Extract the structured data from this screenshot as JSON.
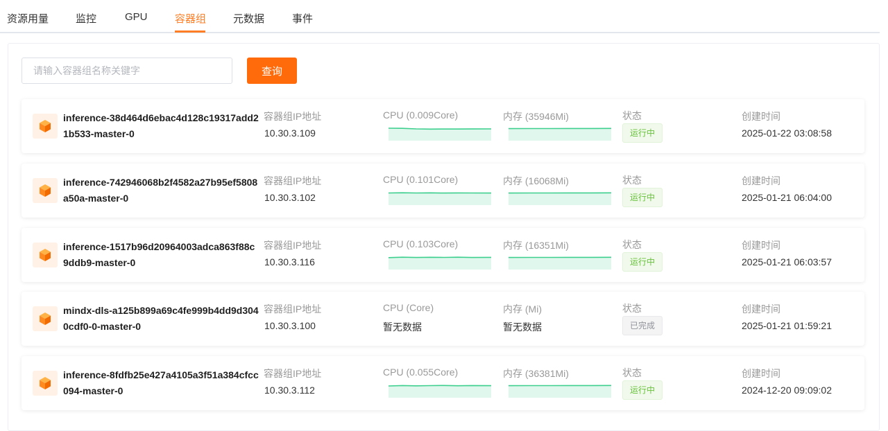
{
  "tabs": [
    {
      "label": "资源用量",
      "active": false
    },
    {
      "label": "监控",
      "active": false
    },
    {
      "label": "GPU",
      "active": false
    },
    {
      "label": "容器组",
      "active": true
    },
    {
      "label": "元数据",
      "active": false
    },
    {
      "label": "事件",
      "active": false
    }
  ],
  "search": {
    "placeholder": "请输入容器组名称关键字",
    "value": "",
    "button_label": "查询"
  },
  "colors": {
    "accent": "#ff7e26",
    "button": "#ff6a0a",
    "running": "#67c23a",
    "sparkline": "#3ccf8e"
  },
  "icons": {
    "pod": "cube-icon"
  },
  "labels": {
    "ip": "容器组IP地址",
    "status": "状态",
    "created": "创建时间"
  },
  "pods": [
    {
      "name": "inference-38d464d6ebac4d128c19317add21b533-master-0",
      "ip": "10.30.3.109",
      "cpu_label": "CPU (0.009Core)",
      "cpu_value": "",
      "mem_label": "内存 (35946Mi)",
      "mem_value": "",
      "has_chart": true,
      "status": "运行中",
      "status_type": "running",
      "created": "2025-01-22 03:08:58"
    },
    {
      "name": "inference-742946068b2f4582a27b95ef5808a50a-master-0",
      "ip": "10.30.3.102",
      "cpu_label": "CPU (0.101Core)",
      "cpu_value": "",
      "mem_label": "内存 (16068Mi)",
      "mem_value": "",
      "has_chart": true,
      "status": "运行中",
      "status_type": "running",
      "created": "2025-01-21 06:04:00"
    },
    {
      "name": "inference-1517b96d20964003adca863f88c9ddb9-master-0",
      "ip": "10.30.3.116",
      "cpu_label": "CPU (0.103Core)",
      "cpu_value": "",
      "mem_label": "内存 (16351Mi)",
      "mem_value": "",
      "has_chart": true,
      "status": "运行中",
      "status_type": "running",
      "created": "2025-01-21 06:03:57"
    },
    {
      "name": "mindx-dls-a125b899a69c4fe999b4dd9d3040cdf0-0-master-0",
      "ip": "10.30.3.100",
      "cpu_label": "CPU (Core)",
      "cpu_value": "暂无数据",
      "mem_label": "内存 (Mi)",
      "mem_value": "暂无数据",
      "has_chart": false,
      "status": "已完成",
      "status_type": "done",
      "created": "2025-01-21 01:59:21"
    },
    {
      "name": "inference-8fdfb25e427a4105a3f51a384cfcc094-master-0",
      "ip": "10.30.3.112",
      "cpu_label": "CPU (0.055Core)",
      "cpu_value": "",
      "mem_label": "内存 (36381Mi)",
      "mem_value": "",
      "has_chart": true,
      "status": "运行中",
      "status_type": "running",
      "created": "2024-12-20 09:09:02"
    }
  ]
}
